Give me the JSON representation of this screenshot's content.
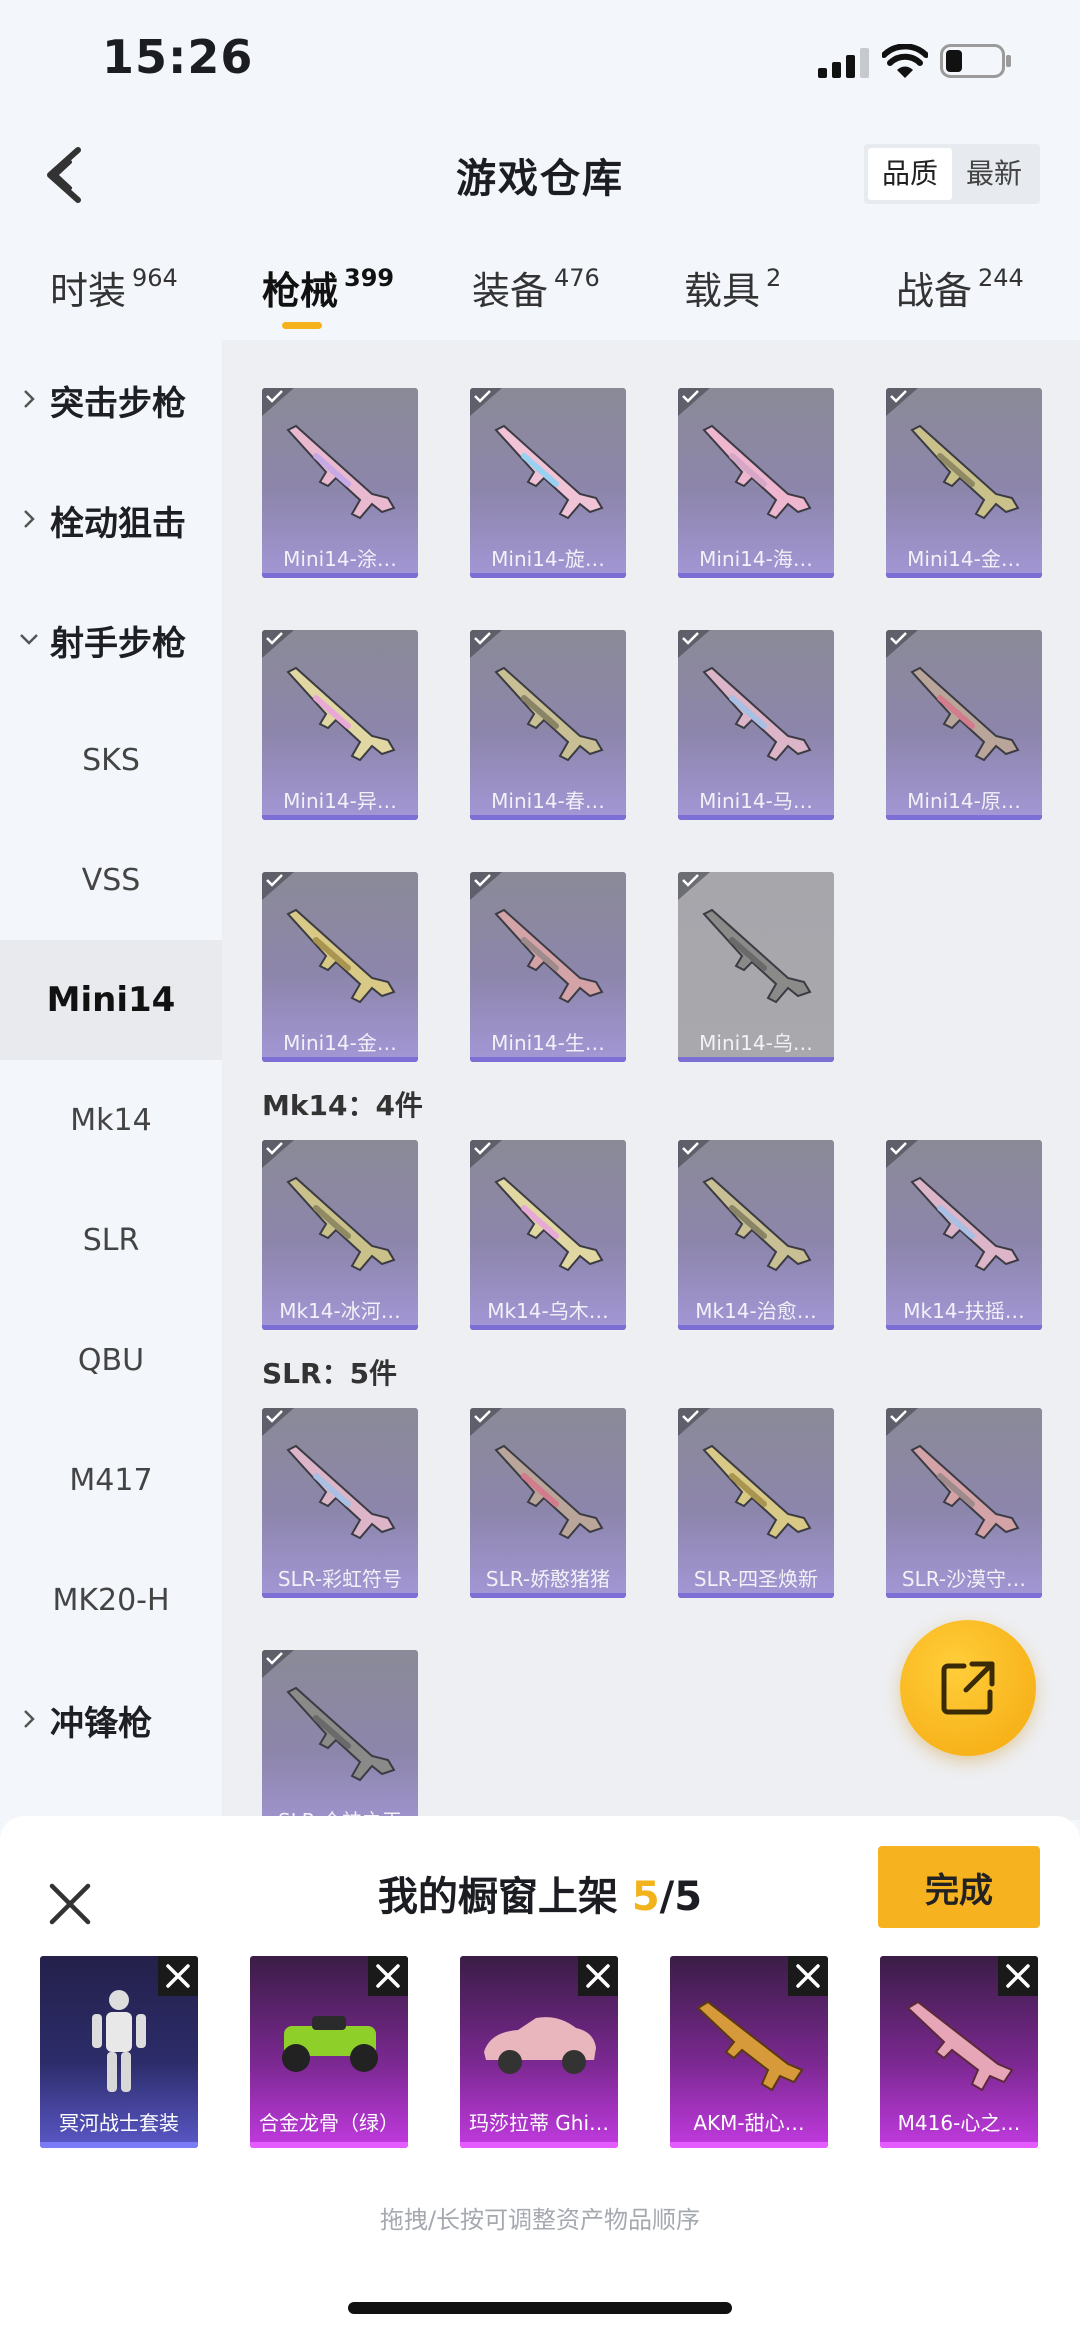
{
  "status_bar": {
    "time": "15:26"
  },
  "header": {
    "title": "游戏仓库",
    "sort_options": [
      "品质",
      "最新"
    ],
    "active_sort": "品质"
  },
  "tabs": [
    {
      "label": "时装",
      "count": "964"
    },
    {
      "label": "枪械",
      "count": "399",
      "active": true
    },
    {
      "label": "装备",
      "count": "476"
    },
    {
      "label": "载具",
      "count": "2"
    },
    {
      "label": "战备",
      "count": "244"
    }
  ],
  "sidebar": {
    "items": [
      {
        "label": "突击步枪",
        "type": "group",
        "expanded": false
      },
      {
        "label": "栓动狙击",
        "type": "group",
        "expanded": false
      },
      {
        "label": "射手步枪",
        "type": "group",
        "expanded": true
      },
      {
        "label": "SKS",
        "type": "sub"
      },
      {
        "label": "VSS",
        "type": "sub"
      },
      {
        "label": "Mini14",
        "type": "sub",
        "active": true
      },
      {
        "label": "Mk14",
        "type": "sub"
      },
      {
        "label": "SLR",
        "type": "sub"
      },
      {
        "label": "QBU",
        "type": "sub"
      },
      {
        "label": "M417",
        "type": "sub"
      },
      {
        "label": "MK20-H",
        "type": "sub"
      },
      {
        "label": "冲锋枪",
        "type": "group",
        "expanded": false
      }
    ]
  },
  "sections": {
    "mini14": {
      "items": [
        "Mini14-涂…",
        "Mini14-旋…",
        "Mini14-海…",
        "Mini14-金…",
        "Mini14-异…",
        "Mini14-春…",
        "Mini14-马…",
        "Mini14-原…",
        "Mini14-金…",
        "Mini14-生…",
        "Mini14-乌…"
      ]
    },
    "mk14": {
      "heading": "Mk14：4件",
      "items": [
        "Mk14-冰河…",
        "Mk14-乌木…",
        "Mk14-治愈…",
        "Mk14-扶摇…"
      ]
    },
    "slr": {
      "heading": "SLR：5件",
      "items": [
        "SLR-彩虹符号",
        "SLR-娇憨猪猪",
        "SLR-四圣焕新",
        "SLR-沙漠守…",
        "SLR-众神之王"
      ]
    }
  },
  "sheet": {
    "title_prefix": "我的橱窗上架",
    "current": "5",
    "separator_total": "/5",
    "done_label": "完成",
    "hint": "拖拽/长按可调整资产物品顺序",
    "items": [
      "冥河战士套装",
      "合金龙骨（绿）",
      "玛莎拉蒂 Ghi…",
      "AKM-甜心…",
      "M416-心之…"
    ]
  },
  "colors": {
    "accent": "#f5b21c",
    "card_purple": "#a397d6",
    "shelf_purple": "#c23ae0"
  }
}
